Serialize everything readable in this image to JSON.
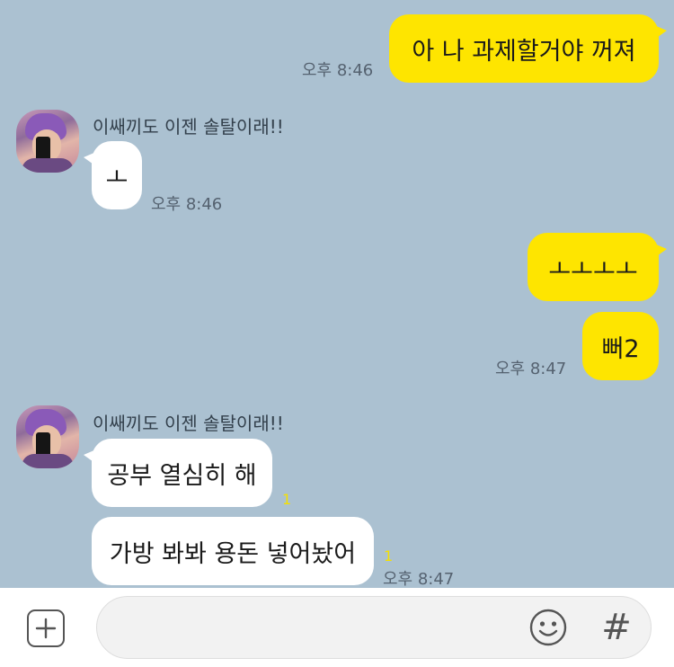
{
  "colors": {
    "background": "#abc1d1",
    "my_bubble": "#fee500",
    "their_bubble": "#ffffff",
    "unread": "#f5e000"
  },
  "messages": [
    {
      "text": "아 나 과제할거야 꺼져",
      "time": "오후 8:46"
    },
    {
      "sender": "이쌔끼도 이젠 솔탈이래!!",
      "avatar_icon": "profile-avatar",
      "text": "ㅗ",
      "time": "오후 8:46"
    },
    {
      "text": "ㅗㅗㅗㅗ"
    },
    {
      "text": "뻐2",
      "time": "오후 8:47"
    },
    {
      "sender": "이쌔끼도 이젠 솔탈이래!!",
      "avatar_icon": "profile-avatar",
      "text": "공부 열심히 해",
      "unread": "1"
    },
    {
      "text": "가방 봐봐 용돈 넣어놨어",
      "unread": "1",
      "time": "오후 8:47"
    }
  ],
  "input": {
    "placeholder": "",
    "plus_icon": "plus-icon",
    "emoji_icon": "emoji-icon",
    "hash_label": "#"
  }
}
